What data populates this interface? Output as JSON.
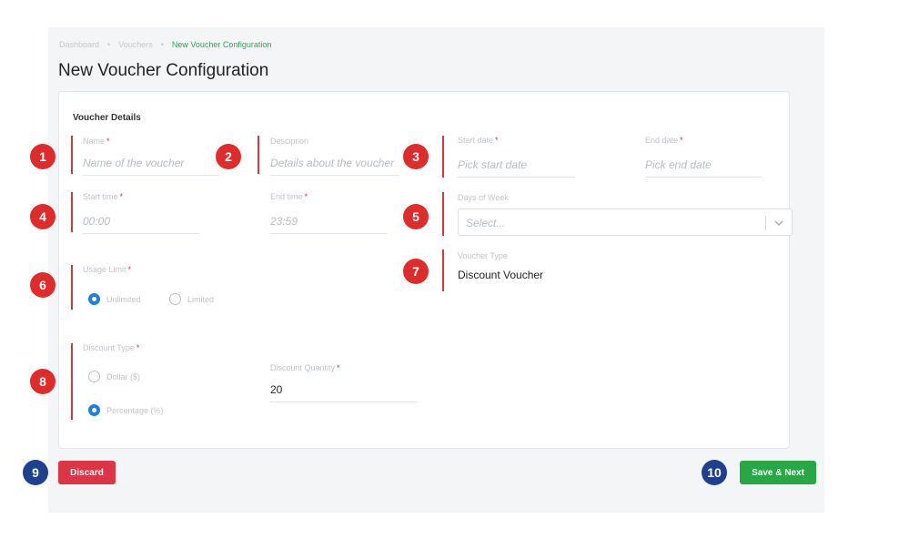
{
  "breadcrumb": {
    "items": [
      "Dashboard",
      "Vouchers"
    ],
    "current": "New Voucher Configuration"
  },
  "page": {
    "title": "New Voucher Configuration"
  },
  "card": {
    "section_title": "Voucher Details"
  },
  "fields": {
    "name": {
      "label": "Name",
      "placeholder": "Name of the voucher"
    },
    "description": {
      "label": "Desciption",
      "placeholder": "Details about the voucher"
    },
    "start_date": {
      "label": "Start date",
      "placeholder": "Pick start date"
    },
    "end_date": {
      "label": "End date",
      "placeholder": "Pick end date"
    },
    "start_time": {
      "label": "Start time",
      "placeholder": "00:00"
    },
    "end_time": {
      "label": "End time",
      "placeholder": "23:59"
    },
    "days_of_week": {
      "label": "Days of Week",
      "placeholder": "Select..."
    },
    "usage_limit": {
      "label": "Usage Limit",
      "options": [
        "Unlimited",
        "Limited"
      ],
      "selected": "Unlimited"
    },
    "voucher_type": {
      "label": "Voucher Type",
      "value": "Discount Voucher"
    },
    "discount_type": {
      "label": "Discount Type",
      "options": [
        "Dollar ($)",
        "Percentage (%)"
      ],
      "selected": "Percentage (%)"
    },
    "discount_quantity": {
      "label": "Discount Quantity",
      "value": "20"
    }
  },
  "required_mark": "*",
  "buttons": {
    "discard": "Discard",
    "save_next": "Save & Next"
  },
  "markers": [
    "1",
    "2",
    "3",
    "4",
    "5",
    "6",
    "7",
    "8",
    "9",
    "10"
  ],
  "colors": {
    "primary": "#1a7fe6",
    "danger": "#dc3545",
    "success": "#28a745",
    "marker_red": "#e02b2b",
    "marker_blue": "#1f3f8f"
  }
}
